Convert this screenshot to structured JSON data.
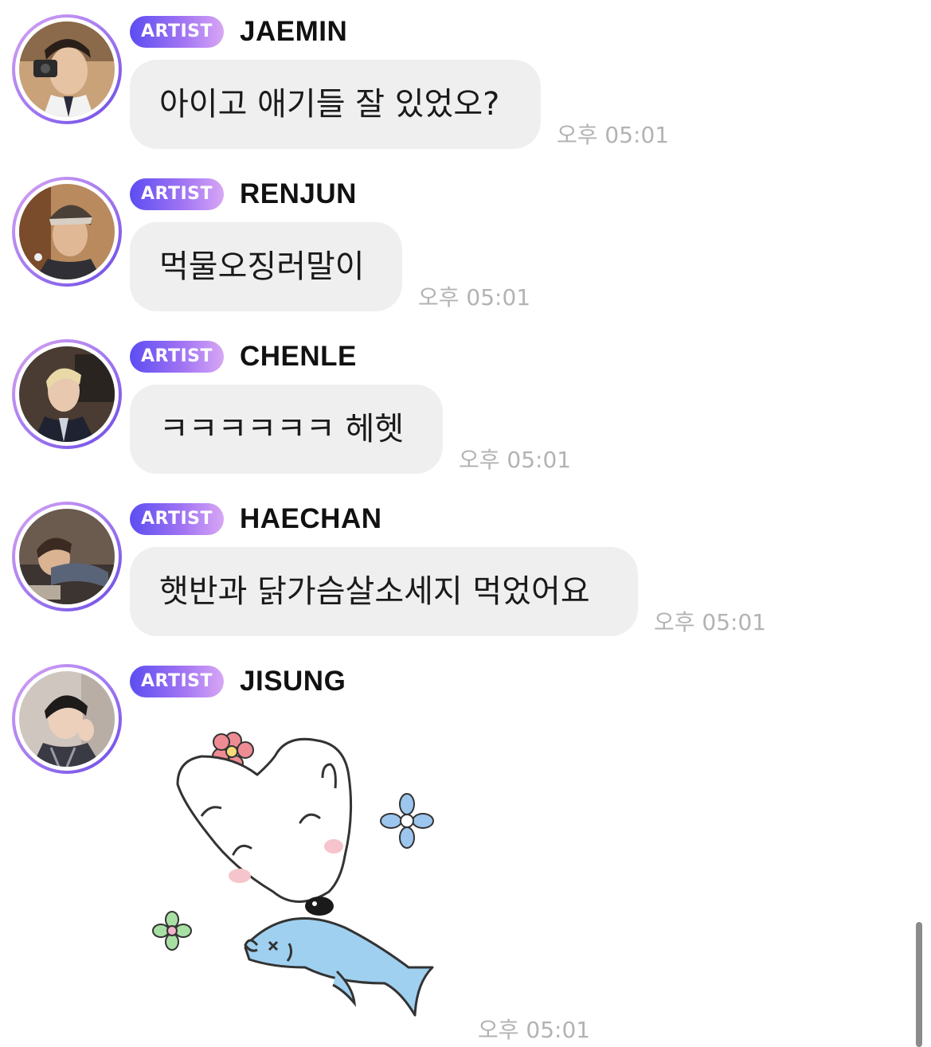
{
  "messages": [
    {
      "badge": "ARTIST",
      "author": "JAEMIN",
      "text": "아이고 애기들 잘 있었오?",
      "time": "오후 05:01"
    },
    {
      "badge": "ARTIST",
      "author": "RENJUN",
      "text": "먹물오징러말이",
      "time": "오후 05:01"
    },
    {
      "badge": "ARTIST",
      "author": "CHENLE",
      "text": "ㅋㅋㅋㅋㅋㅋ 헤헷",
      "time": "오후 05:01"
    },
    {
      "badge": "ARTIST",
      "author": "HAECHAN",
      "text": "햇반과 닭가슴살소세지 먹었어요",
      "time": "오후 05:01"
    },
    {
      "badge": "ARTIST",
      "author": "JISUNG",
      "sticker": "bunny-with-fish-sticker",
      "time": "오후 05:01"
    }
  ],
  "colors": {
    "badge_gradient": [
      "#5c4df2",
      "#d7a6f5"
    ],
    "bubble": "#efefef",
    "timestamp": "#b3b3b3",
    "avatar_ring": [
      "#d8a4f3",
      "#6a4ae6"
    ]
  }
}
